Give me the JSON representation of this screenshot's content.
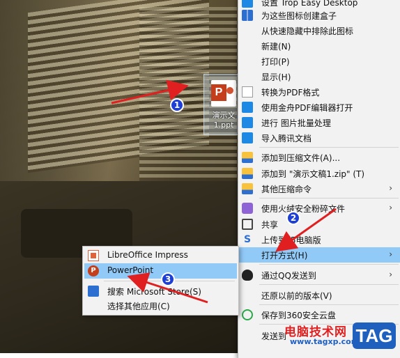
{
  "desktop": {
    "file": {
      "name_line1": "演示文",
      "name_line2": "1.ppt"
    }
  },
  "context_menu": {
    "items": [
      {
        "label": "设置 Trop Easy Desktop",
        "icon": "app-icon"
      },
      {
        "label": "为这些图标创建盒子",
        "icon": "grid-icon"
      },
      {
        "label": "从快速隐藏中排除此图标",
        "icon": ""
      },
      {
        "label": "新建(N)",
        "icon": ""
      },
      {
        "label": "打印(P)",
        "icon": ""
      },
      {
        "label": "显示(H)",
        "icon": ""
      },
      {
        "label": "转换为PDF格式",
        "icon": "document-icon"
      },
      {
        "label": "使用金舟PDF编辑器打开",
        "icon": "pdf-editor-icon"
      },
      {
        "label": "进行 图片批量处理",
        "icon": "image-batch-icon"
      },
      {
        "label": "导入腾讯文档",
        "icon": "tencent-docs-icon"
      },
      {
        "label": "添加到压缩文件(A)...",
        "icon": "zip-icon"
      },
      {
        "label": "添加到 \"演示文稿1.zip\" (T)",
        "icon": "zip-icon"
      },
      {
        "label": "其他压缩命令",
        "icon": "zip-icon",
        "arrow": "›"
      },
      {
        "label": "使用火绒安全粉碎文件",
        "icon": "shredder-icon",
        "arrow": "›"
      },
      {
        "label": "共享",
        "icon": "share-icon"
      },
      {
        "label": "上传到",
        "suffix": "5电脑版",
        "icon": "upload-icon"
      },
      {
        "label": "打开方式(H)",
        "icon": "",
        "arrow": "›",
        "highlighted": true
      },
      {
        "label": "通过QQ发送到",
        "icon": "qq-icon",
        "arrow": "›"
      },
      {
        "label": "还原以前的版本(V)",
        "icon": ""
      },
      {
        "label": "保存到360安全云盘",
        "icon": "cloud-360-icon"
      },
      {
        "label": "发送到",
        "icon": ""
      }
    ]
  },
  "open_with_menu": {
    "items": [
      {
        "label": "LibreOffice Impress",
        "icon": "libreoffice-impress-icon"
      },
      {
        "label": "PowerPoint",
        "icon": "powerpoint-icon",
        "highlighted": true
      },
      {
        "label": "搜索 Microsoft Store(S)",
        "icon": "store-icon"
      },
      {
        "label": "选择其他应用(C)",
        "icon": ""
      }
    ]
  },
  "annotations": {
    "badges": [
      "1",
      "2",
      "3"
    ],
    "arrow_color": "#e02020",
    "badge_color": "#1e3fd6"
  },
  "watermark": {
    "text": "电脑技术网",
    "url": "www.tagxp.com",
    "tag": "TAG"
  },
  "colors": {
    "menu_bg": "#f2f2f2",
    "highlight": "#91c9f7"
  }
}
